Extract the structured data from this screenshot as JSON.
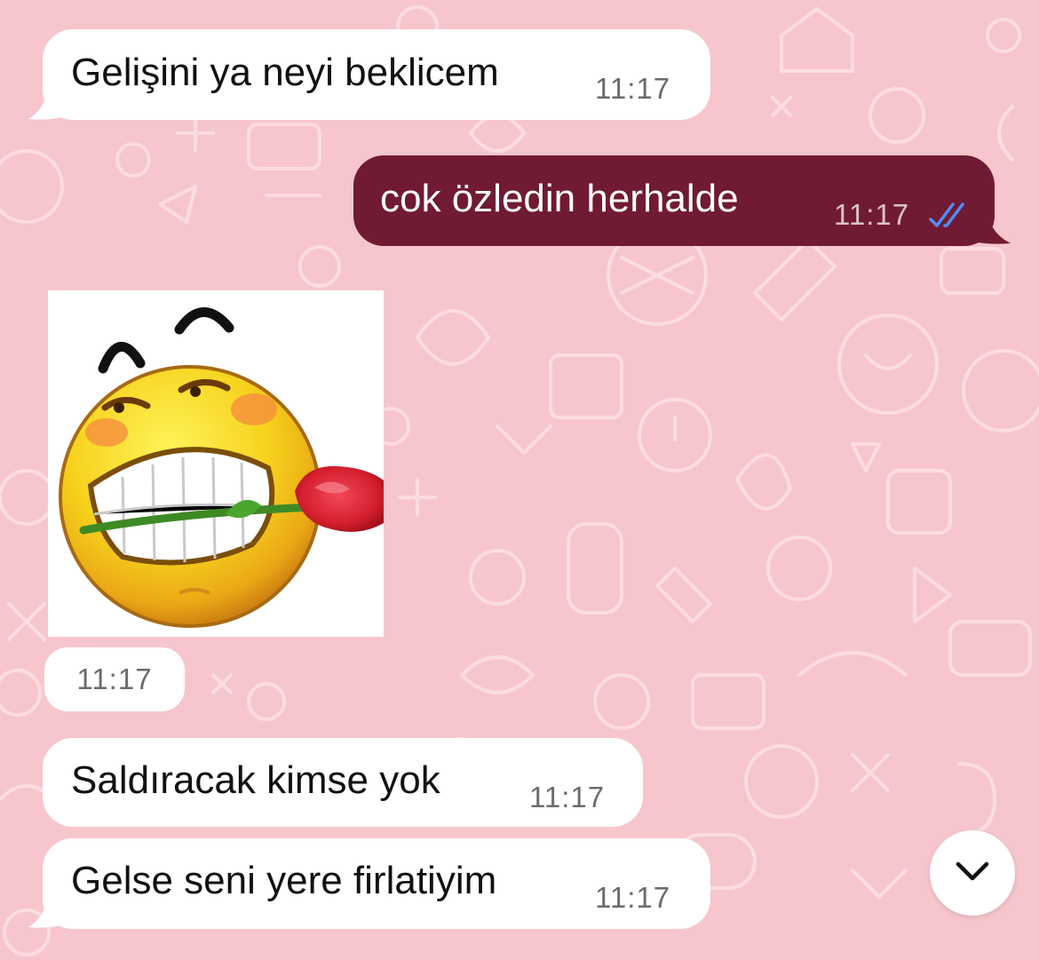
{
  "theme": {
    "wallpaper_color": "#f7c6cd",
    "incoming_bubble_color": "#ffffff",
    "outgoing_bubble_color": "#711a33",
    "read_tick_color": "#4f8ef7"
  },
  "messages": [
    {
      "direction": "incoming",
      "text": "Gelişini ya neyi beklicem",
      "time": "11:17"
    },
    {
      "direction": "outgoing",
      "text": "cok özledin herhalde",
      "time": "11:17",
      "status": "read-double-check-icon"
    },
    {
      "direction": "incoming",
      "type": "sticker",
      "sticker": "grinning-face-with-rose-sticker",
      "time": "11:17"
    },
    {
      "direction": "incoming",
      "text": "Saldıracak kimse yok",
      "time": "11:17"
    },
    {
      "direction": "incoming",
      "text": "Gelse seni yere firlatiyim",
      "time": "11:17"
    }
  ],
  "scroll_button_icon": "chevron-down-icon"
}
